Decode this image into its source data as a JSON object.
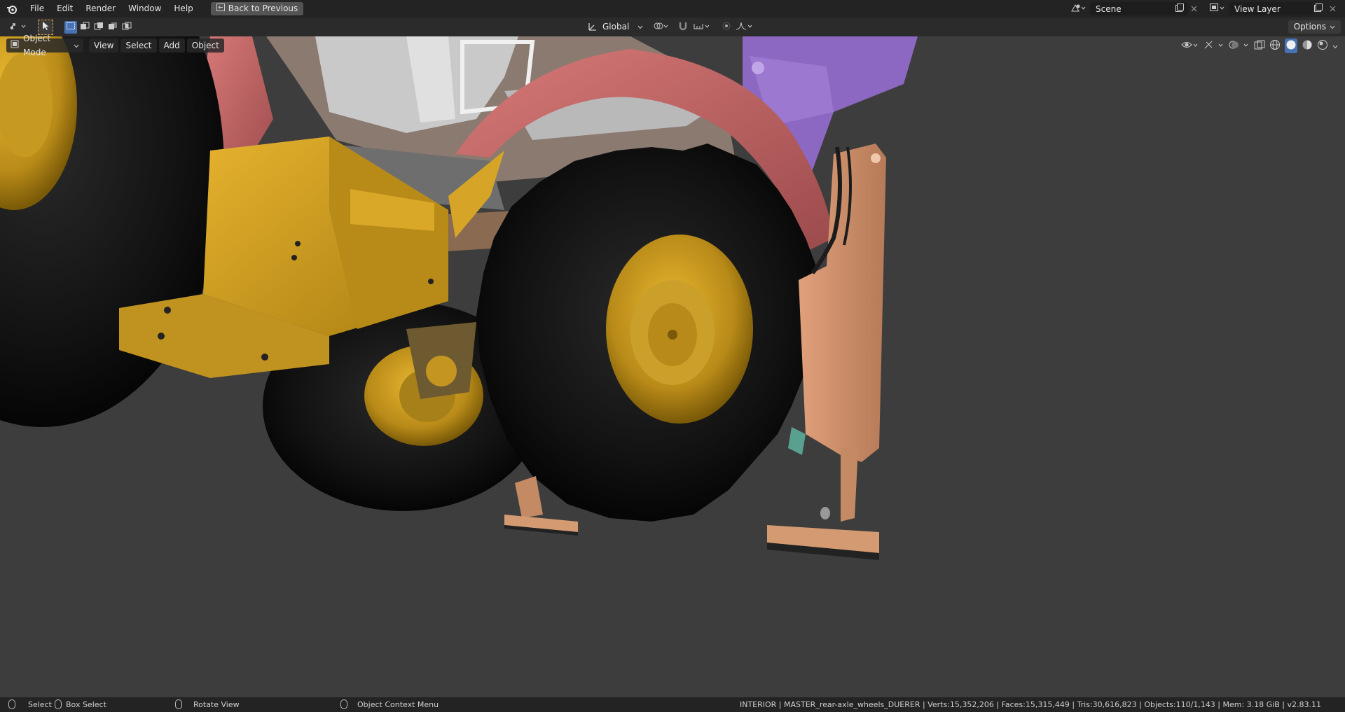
{
  "menubar": {
    "items": [
      "File",
      "Edit",
      "Render",
      "Window",
      "Help"
    ],
    "back_button": "Back to Previous",
    "scene_name": "Scene",
    "view_layer_name": "View Layer"
  },
  "toolheader": {
    "transform_orientation": "Global",
    "options_label": "Options"
  },
  "viewport_header": {
    "mode": "Object Mode",
    "menus": [
      "View",
      "Select",
      "Add",
      "Object"
    ]
  },
  "statusbar": {
    "select": "Select",
    "box_select": "Box Select",
    "rotate_view": "Rotate View",
    "context_menu": "Object Context Menu",
    "stats": "INTERIOR | MASTER_rear-axle_wheels_DUERER | Verts:15,352,206 | Faces:15,315,449 | Tris:30,616,823 | Objects:110/1,143 | Mem: 3.18 GiB | v2.83.11"
  },
  "colors": {
    "topbar": "#232323",
    "header": "#2b2b2b",
    "viewport": "#3d3d3d",
    "accent": "#4772b3"
  }
}
